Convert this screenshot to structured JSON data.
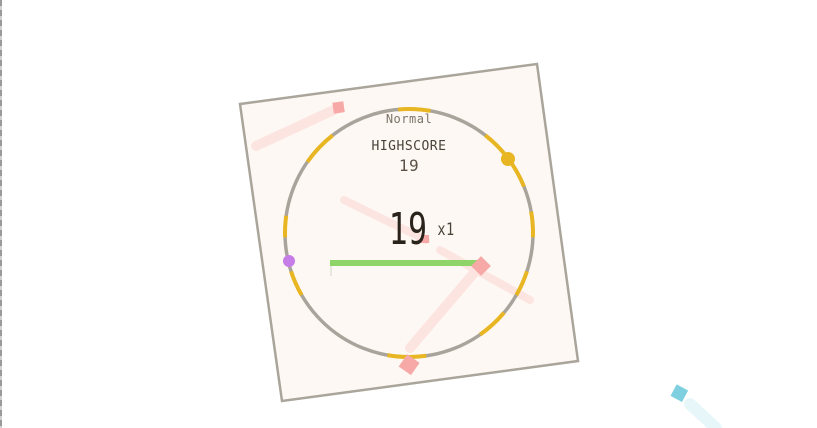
{
  "game": {
    "mode": "Normal",
    "highscore_label": "HIGHSCORE",
    "highscore": "19",
    "score": "19",
    "multiplier": "x1"
  },
  "colors": {
    "background": "#ffffff",
    "board_fill": "#fef8f4",
    "board_border": "#aaa59b",
    "ring": "#a9a49b",
    "ring_segments": "#e8b622",
    "timer_bar": "#8fd468",
    "enemy": "#f6a9a6",
    "enemy_trail": "#fbd6d3",
    "player": "#c77de8",
    "goal_dot": "#e8b622",
    "cyan_square": "#7ed0e0"
  },
  "timer": {
    "fraction_remaining": 0.98
  },
  "icons": {
    "player": "purple-dot-icon",
    "target": "yellow-dot-icon",
    "enemy": "pink-square-icon"
  }
}
